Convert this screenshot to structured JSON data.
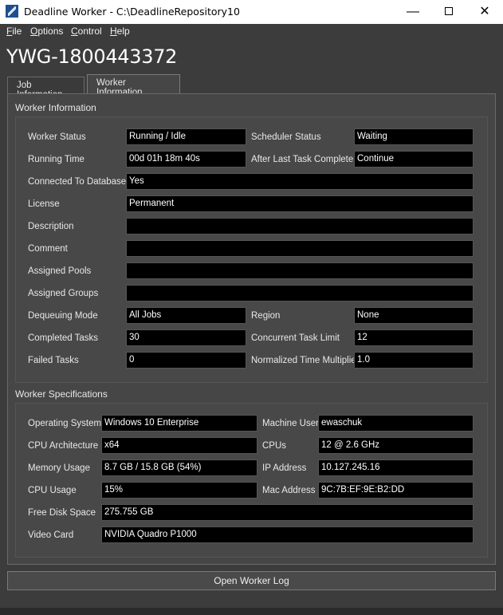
{
  "window": {
    "title": "Deadline Worker  -  C:\\DeadlineRepository10",
    "minimize": "—",
    "close": "✕"
  },
  "menu": [
    {
      "label": "File",
      "mnemonic": "F",
      "rest": "ile"
    },
    {
      "label": "Options",
      "mnemonic": "O",
      "rest": "ptions"
    },
    {
      "label": "Control",
      "mnemonic": "C",
      "rest": "ontrol"
    },
    {
      "label": "Help",
      "mnemonic": "H",
      "rest": "elp"
    }
  ],
  "hostname": "YWG-1800443372",
  "tabs": [
    {
      "label": "Job Information",
      "active": false
    },
    {
      "label": "Worker Information",
      "active": true
    }
  ],
  "worker_info": {
    "group_title": "Worker Information",
    "worker_status": {
      "label": "Worker Status",
      "value": "Running / Idle"
    },
    "scheduler_status": {
      "label": "Scheduler Status",
      "value": "Waiting"
    },
    "running_time": {
      "label": "Running Time",
      "value": "00d 01h 18m 40s"
    },
    "after_last_task": {
      "label": "After Last Task Complete",
      "value": "Continue"
    },
    "connected_db": {
      "label": "Connected To Database",
      "value": "Yes"
    },
    "license": {
      "label": "License",
      "value": "Permanent"
    },
    "description": {
      "label": "Description",
      "value": ""
    },
    "comment": {
      "label": "Comment",
      "value": ""
    },
    "assigned_pools": {
      "label": "Assigned Pools",
      "value": ""
    },
    "assigned_groups": {
      "label": "Assigned Groups",
      "value": ""
    },
    "dequeuing_mode": {
      "label": "Dequeuing Mode",
      "value": "All Jobs"
    },
    "region": {
      "label": "Region",
      "value": "None"
    },
    "completed_tasks": {
      "label": "Completed Tasks",
      "value": "30"
    },
    "concurrent_limit": {
      "label": "Concurrent Task Limit",
      "value": "12"
    },
    "failed_tasks": {
      "label": "Failed Tasks",
      "value": "0"
    },
    "time_multiplier": {
      "label": "Normalized Time Multiplier",
      "value": "1.0"
    }
  },
  "worker_specs": {
    "group_title": "Worker Specifications",
    "os": {
      "label": "Operating System",
      "value": "Windows 10 Enterprise"
    },
    "machine_user": {
      "label": "Machine User",
      "value": "ewaschuk"
    },
    "cpu_arch": {
      "label": "CPU Architecture",
      "value": "x64"
    },
    "cpus": {
      "label": "CPUs",
      "value": "12 @ 2.6 GHz"
    },
    "memory": {
      "label": "Memory Usage",
      "value": "8.7 GB / 15.8 GB (54%)"
    },
    "ip": {
      "label": "IP Address",
      "value": "10.127.245.16"
    },
    "cpu_usage": {
      "label": "CPU Usage",
      "value": "15%"
    },
    "mac": {
      "label": "Mac Address",
      "value": "9C:7B:EF:9E:B2:DD"
    },
    "disk": {
      "label": "Free Disk Space",
      "value": "275.755 GB"
    },
    "video": {
      "label": "Video Card",
      "value": "NVIDIA Quadro P1000"
    }
  },
  "actions": {
    "open_log": "Open Worker Log"
  },
  "colors": {
    "background": "#3c3c3c",
    "panel": "#464646",
    "field": "#000000",
    "titlebar": "#ffffff"
  }
}
